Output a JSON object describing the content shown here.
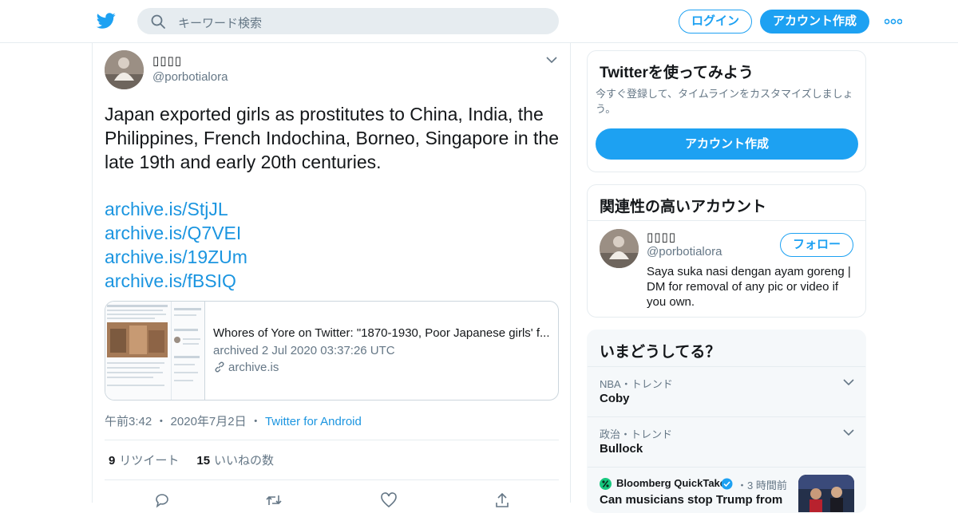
{
  "header": {
    "search_placeholder": "キーワード検索",
    "login_label": "ログイン",
    "signup_label": "アカウント作成"
  },
  "tweet": {
    "display_name": "▯▯▯▯",
    "handle": "@porbotialora",
    "text": "Japan exported girls as prostitutes to China, India, the Philippines, French Indochina, Borneo, Singapore in the late 19th and early 20th centuries.",
    "links": [
      "archive.is/StjJL",
      "archive.is/Q7VEI",
      "archive.is/19ZUm",
      "archive.is/fBSIQ"
    ],
    "card": {
      "title": "Whores of Yore on Twitter: \"1870-1930, Poor Japanese girls' f...",
      "description": "archived 2 Jul 2020 03:37:26 UTC",
      "domain": "archive.is"
    },
    "time": "午前3:42",
    "date": "2020年7月2日",
    "source": "Twitter for Android",
    "retweet_count": "9",
    "retweet_label": "リツイート",
    "like_count": "15",
    "like_label": "いいねの数"
  },
  "sidebar": {
    "signup_panel": {
      "title": "Twitterを使ってみよう",
      "description": "今すぐ登録して、タイムラインをカスタマイズしましょう。",
      "button_label": "アカウント作成"
    },
    "related": {
      "title": "関連性の高いアカウント",
      "display_name": "▯▯▯▯",
      "handle": "@porbotialora",
      "follow_label": "フォロー",
      "bio": "Saya suka nasi dengan ayam goreng | DM for removal of any pic or video if you own."
    },
    "trends": {
      "title": "いまどうしてる？",
      "items": [
        {
          "context": "NBA・トレンド",
          "name": "Coby"
        },
        {
          "context": "政治・トレンド",
          "name": "Bullock"
        }
      ],
      "news": {
        "source": "Bloomberg QuickTake",
        "time": "3 時間前",
        "headline": "Can musicians stop Trump from"
      }
    }
  },
  "colors": {
    "accent": "#1da1f2",
    "link": "#1b95e0",
    "text": "#14171a",
    "secondary_text": "#657786",
    "border": "#e6ecf0"
  },
  "icons": [
    "twitter-bird-icon",
    "search-icon",
    "more-dots-icon",
    "chevron-down-icon",
    "link-icon",
    "reply-icon",
    "retweet-icon",
    "like-icon",
    "share-icon",
    "verified-badge-icon"
  ]
}
